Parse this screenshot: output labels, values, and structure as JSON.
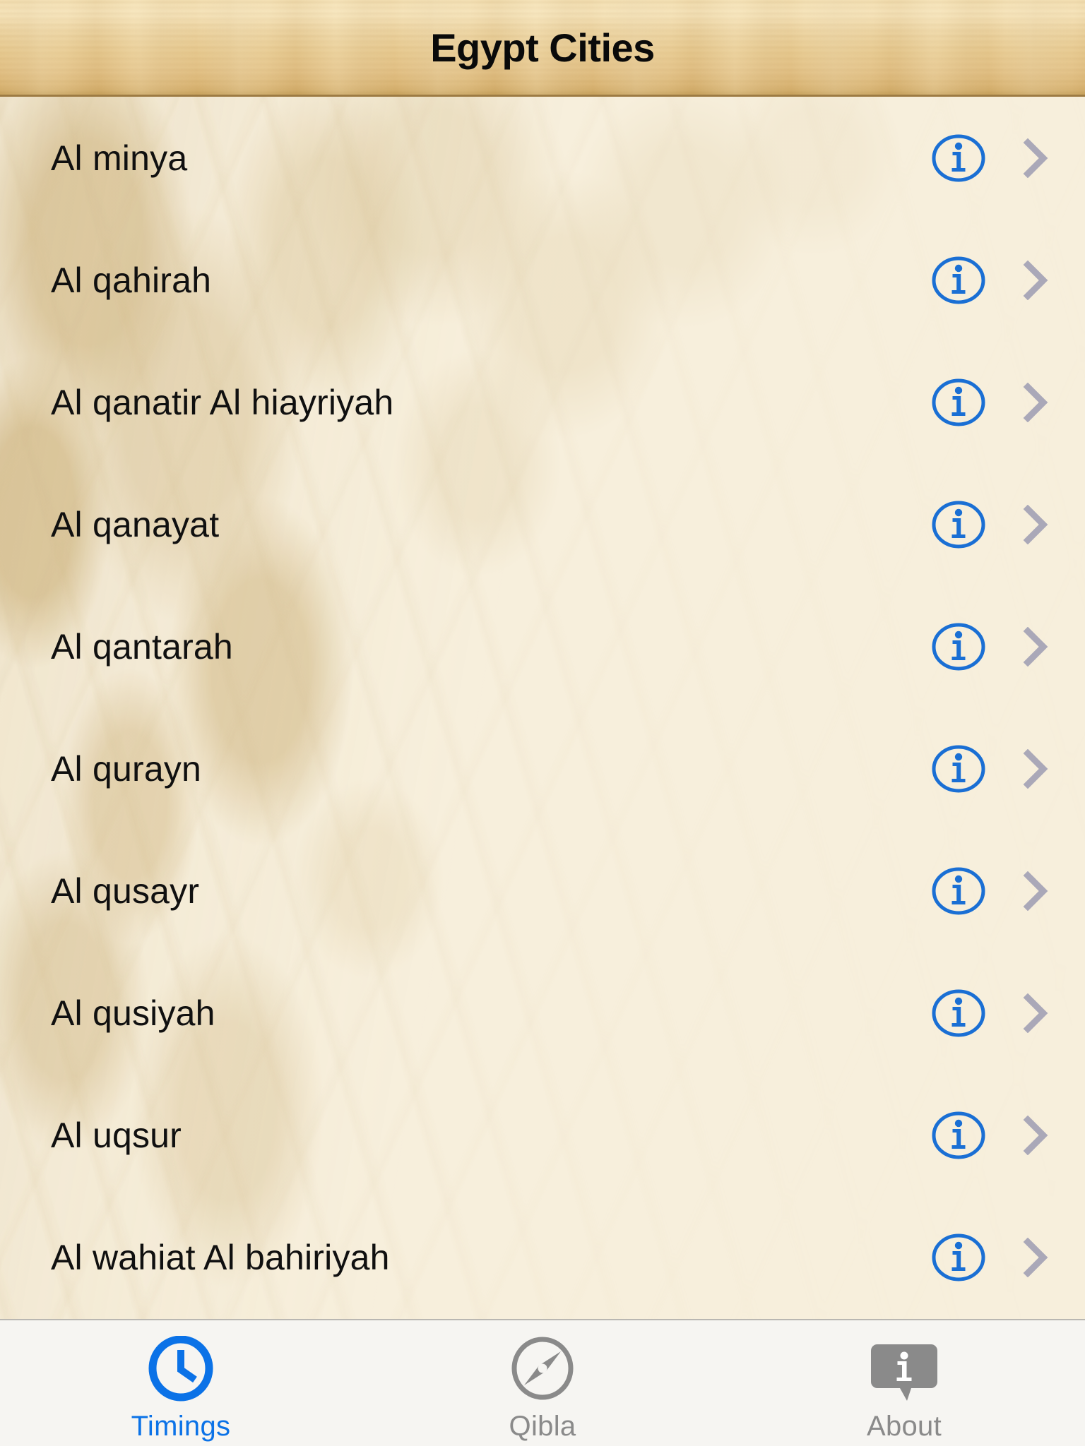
{
  "header": {
    "title": "Egypt Cities"
  },
  "list": {
    "accessory": {
      "info_icon": "info-circle-icon",
      "disclosure_icon": "chevron-right-icon"
    },
    "rows": [
      {
        "name": "Al minya"
      },
      {
        "name": "Al qahirah"
      },
      {
        "name": "Al qanatir Al hiayriyah"
      },
      {
        "name": "Al qanayat"
      },
      {
        "name": "Al qantarah"
      },
      {
        "name": "Al qurayn"
      },
      {
        "name": "Al qusayr"
      },
      {
        "name": "Al qusiyah"
      },
      {
        "name": "Al uqsur"
      },
      {
        "name": "Al wahiat Al bahiriyah"
      }
    ]
  },
  "tabbar": {
    "tabs": [
      {
        "label": "Timings",
        "icon": "clock-icon",
        "selected": true
      },
      {
        "label": "Qibla",
        "icon": "compass-icon",
        "selected": false
      },
      {
        "label": "About",
        "icon": "info-bubble-icon",
        "selected": false
      }
    ]
  },
  "colors": {
    "accent_blue": "#0b72e7",
    "info_blue": "#1a6fd4",
    "chevron_gray": "#aaa8b8",
    "tab_inactive_gray": "#8a8a8a",
    "parchment": "#f7efdc",
    "ornament_tan": "#dbc69b",
    "wood_light": "#f3dfb2",
    "wood_dark": "#c9a45f",
    "title_black": "#0a0a0a"
  }
}
